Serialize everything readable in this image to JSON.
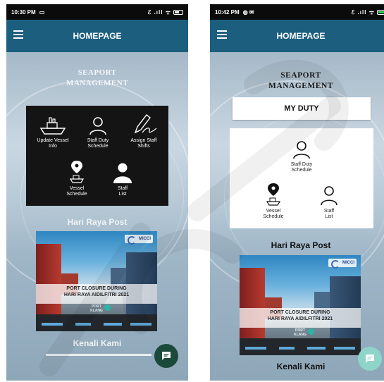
{
  "screens": [
    {
      "status": {
        "time": "10:30 PM",
        "icons": "ℰ .ıll ᯤ"
      },
      "appbar": {
        "title": "HOMEPAGE"
      },
      "brand": {
        "line1": "SEAPORT",
        "line2": "MANAGEMENT"
      },
      "menu": [
        {
          "label1": "Update Vessel",
          "label2": "Info",
          "icon": "ship-icon"
        },
        {
          "label1": "Staff Duty",
          "label2": "Schedule",
          "icon": "person-outline-icon"
        },
        {
          "label1": "Assign Staff",
          "label2": "Shifts",
          "icon": "pen-icon"
        },
        {
          "label1": "Vessel",
          "label2": "Schedule",
          "icon": "vessel-location-icon"
        },
        {
          "label1": "Staff",
          "label2": "List",
          "icon": "person-filled-icon"
        }
      ],
      "sections": {
        "post_title": "Hari Raya Post",
        "about_title": "Kenali Kami"
      },
      "post": {
        "logo": "MICCI",
        "line1": "PORT CLOSURE DURING",
        "line2": "HARI RAYA AIDILFITRI 2021",
        "port": "PORT KLANG"
      }
    },
    {
      "status": {
        "time": "10:42 PM",
        "icons": "ℰ .ıll ᯤ"
      },
      "appbar": {
        "title": "HOMEPAGE"
      },
      "brand": {
        "line1": "SEAPORT",
        "line2": "MANAGEMENT"
      },
      "duty_button": "MY DUTY",
      "menu": [
        {
          "label1": "Staff Duty",
          "label2": "Schedule",
          "icon": "person-outline-icon"
        },
        {
          "label1": "Vessel",
          "label2": "Schedule",
          "icon": "vessel-location-icon"
        },
        {
          "label1": "Staff",
          "label2": "List",
          "icon": "person-outline-icon"
        }
      ],
      "sections": {
        "post_title": "Hari Raya Post",
        "about_title": "Kenali Kami"
      },
      "post": {
        "logo": "MICCI",
        "line1": "PORT CLOSURE DURING",
        "line2": "HARI RAYA AIDILFITRI 2021",
        "port": "PORT KLANG"
      }
    }
  ],
  "colors": {
    "appbar": "#1b5e7e",
    "dark_card": "#141414",
    "chat_left": "#1b4a3a",
    "chat_right": "#8fd4c8"
  }
}
